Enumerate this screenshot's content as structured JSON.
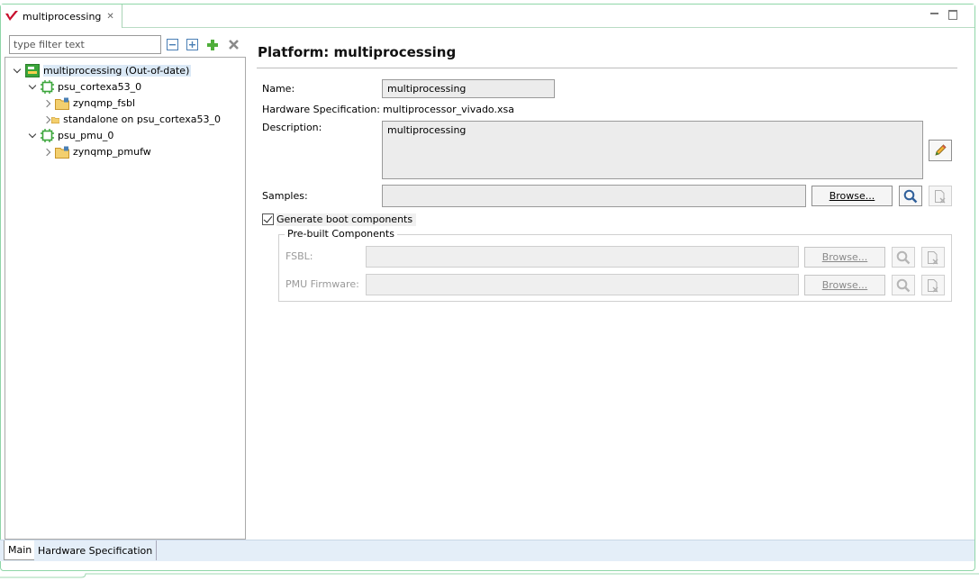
{
  "editor_tab": {
    "title": "multiprocessing"
  },
  "filter": {
    "placeholder": "type filter text"
  },
  "tree": {
    "root": "multiprocessing (Out-of-date)",
    "cortex": "psu_cortexa53_0",
    "fsbl": "zynqmp_fsbl",
    "standalone": "standalone on psu_cortexa53_0",
    "pmu": "psu_pmu_0",
    "pmufw": "zynqmp_pmufw"
  },
  "page_tabs": {
    "main": "Main",
    "hw": "Hardware Specification"
  },
  "form": {
    "title": "Platform: multiprocessing",
    "name_label": "Name:",
    "name_value": "multiprocessing",
    "hw_label": "Hardware Specification:",
    "hw_value": "multiprocessor_vivado.xsa",
    "desc_label": "Description:",
    "desc_value": "multiprocessing",
    "samples_label": "Samples:",
    "samples_value": "",
    "browse_label": "Browse...",
    "boot_label": "Generate boot components",
    "boot_checked": true,
    "prebuilt_title": "Pre-built Components",
    "fsbl_label": "FSBL:",
    "fsbl_value": "",
    "pmu_label": "PMU Firmware:",
    "pmu_value": ""
  },
  "colors": {
    "accent_green": "#3aa53a",
    "selection": "#dbe9f6",
    "folder": "#e8b64c"
  }
}
